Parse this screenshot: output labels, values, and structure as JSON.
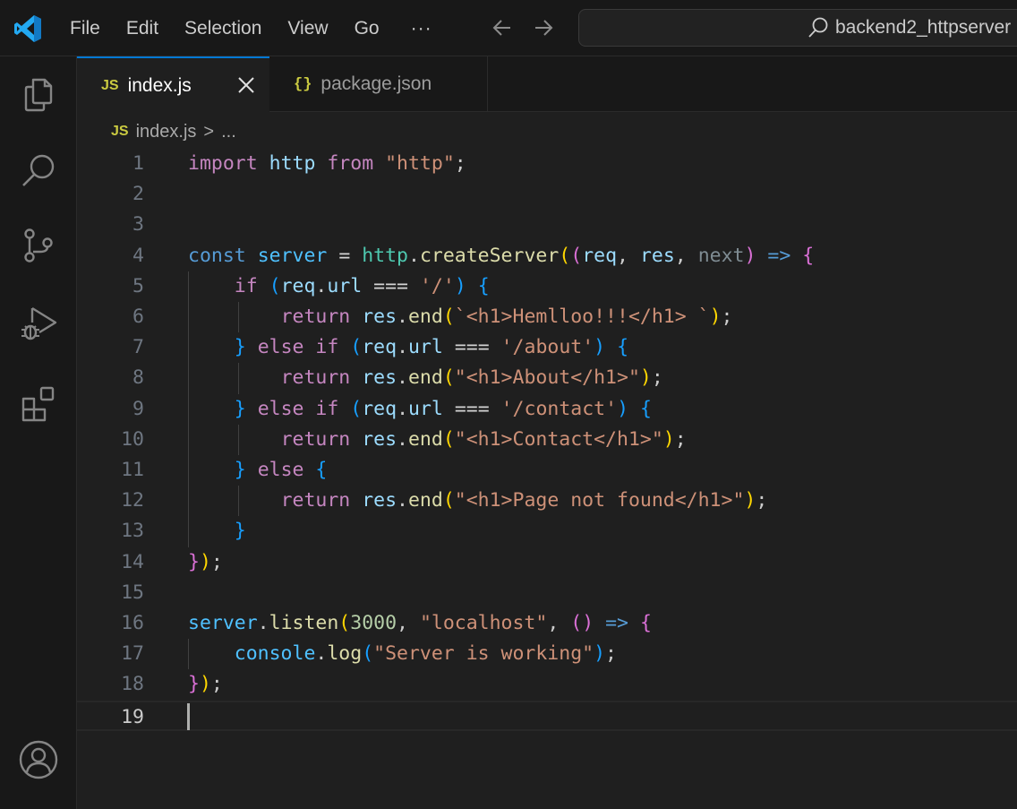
{
  "titlebar": {
    "menu": [
      "File",
      "Edit",
      "Selection",
      "View",
      "Go"
    ],
    "more": "···",
    "search_text": "backend2_httpserver"
  },
  "activity_bar": {
    "items": [
      "explorer-icon",
      "search-icon",
      "source-control-icon",
      "run-debug-icon",
      "extensions-icon"
    ],
    "bottom": [
      "account-icon"
    ]
  },
  "tabs": [
    {
      "label": "index.js",
      "badge": "JS",
      "active": true
    },
    {
      "label": "package.json",
      "badge": "{}",
      "active": false
    }
  ],
  "breadcrumb": {
    "badge": "JS",
    "file": "index.js",
    "separator": ">",
    "rest": "..."
  },
  "editor": {
    "current_line": 19,
    "lines": [
      "import http from \"http\";",
      "",
      "",
      "const server = http.createServer((req, res, next) => {",
      "    if (req.url === '/') {",
      "        return res.end(`<h1>Hemlloo!!!</h1> `);",
      "    } else if (req.url === '/about') {",
      "        return res.end(\"<h1>About</h1>\");",
      "    } else if (req.url === '/contact') {",
      "        return res.end(\"<h1>Contact</h1>\");",
      "    } else {",
      "        return res.end(\"<h1>Page not found</h1>\");",
      "    }",
      "});",
      "",
      "server.listen(3000, \"localhost\", () => {",
      "    console.log(\"Server is working\");",
      "});",
      ""
    ],
    "line_numbers": [
      "1",
      "2",
      "3",
      "4",
      "5",
      "6",
      "7",
      "8",
      "9",
      "10",
      "11",
      "12",
      "13",
      "14",
      "15",
      "16",
      "17",
      "18",
      "19"
    ]
  },
  "colors": {
    "accent": "#0078d4",
    "background": "#1f1f1f",
    "keyword": "#c586c0",
    "string": "#ce9178",
    "function": "#dcdcaa"
  }
}
